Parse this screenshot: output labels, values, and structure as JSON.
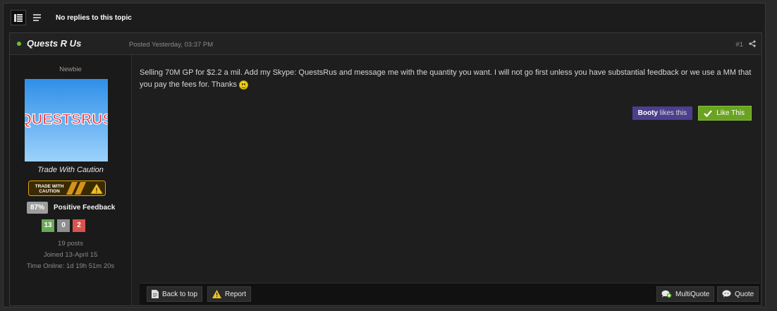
{
  "topbar": {
    "status_text": "No replies to this topic"
  },
  "post": {
    "author": "Quests R Us",
    "date": "Posted Yesterday, 03:37 PM",
    "number": "#1",
    "group": "Newbie",
    "avatar_text": "QUESTSRUS",
    "custom_title": "Trade With Caution",
    "rank_badge_text": [
      "TRADE WITH",
      "CAUTION"
    ],
    "feedback": {
      "percent": "87%",
      "label": "Positive Feedback",
      "positive": "13",
      "neutral": "0",
      "negative": "2",
      "colors": {
        "positive": "#6aa85a",
        "neutral": "#8e8e8e",
        "negative": "#d9534f"
      }
    },
    "posts": "19 posts",
    "joined": "Joined 13-April 15",
    "time_online": "Time Online: 1d 19h 51m 20s",
    "body": "Selling 70M GP for $2.2 a mil. Add my Skype: QuestsRus and message me with the quantity you want. I will not go first unless you have substantial feedback or we use a MM that you pay the fees for. Thanks",
    "likes": {
      "user": "Booty",
      "suffix": "likes this"
    },
    "like_button": "Like This"
  },
  "footer": {
    "back_to_top": "Back to top",
    "report": "Report",
    "multiquote": "MultiQuote",
    "quote": "Quote"
  },
  "colors": {
    "accent_purple": "#4b3f8e",
    "like_green": "#6aa322",
    "online_green": "#6fbf3a"
  }
}
